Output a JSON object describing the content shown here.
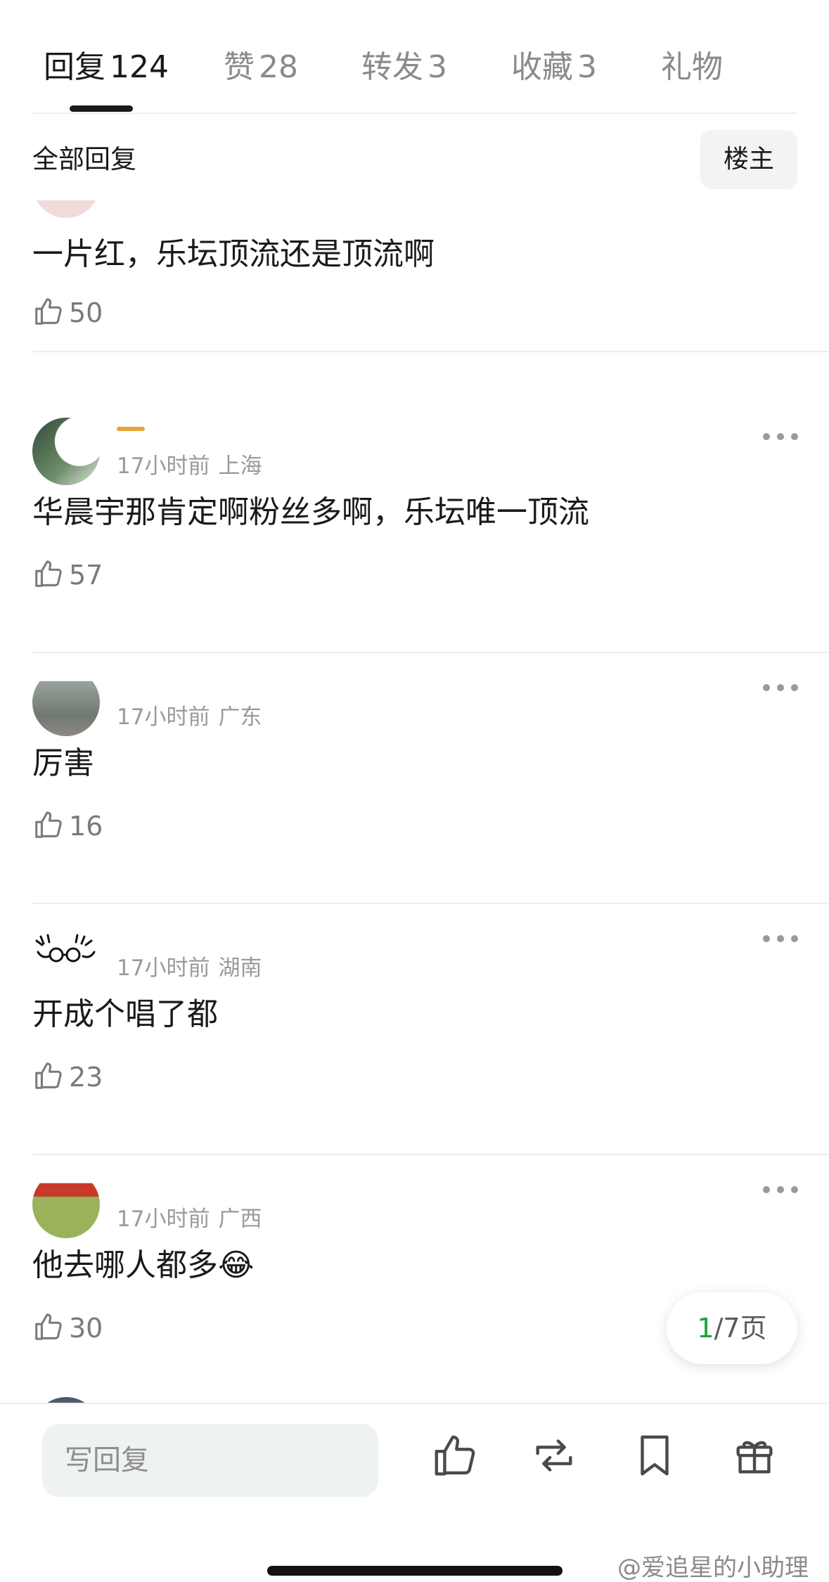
{
  "tabs": [
    {
      "label": "回复",
      "count": "124"
    },
    {
      "label": "赞",
      "count": "28"
    },
    {
      "label": "转发",
      "count": "3"
    },
    {
      "label": "收藏",
      "count": "3"
    },
    {
      "label": "礼物",
      "count": ""
    }
  ],
  "filter": {
    "label": "全部回复",
    "louzhu": "楼主"
  },
  "comments": [
    {
      "time": "",
      "location": "",
      "text": "一片红，乐坛顶流还是顶流啊",
      "likes": "50"
    },
    {
      "time": "17小时前",
      "location": "上海",
      "text": "华晨宇那肯定啊粉丝多啊，乐坛唯一顶流",
      "likes": "57"
    },
    {
      "time": "17小时前",
      "location": "广东",
      "text": "厉害",
      "likes": "16"
    },
    {
      "time": "17小时前",
      "location": "湖南",
      "text": "开成个唱了都",
      "likes": "23"
    },
    {
      "time": "17小时前",
      "location": "广西",
      "text": "他去哪人都多😂",
      "likes": "30"
    }
  ],
  "pagination": {
    "current": "1",
    "total": "/7",
    "unit": "页"
  },
  "bottom": {
    "reply_placeholder": "写回复"
  },
  "watermark": "@爱追星的小助理",
  "colors": {
    "accent_green": "#1f9e3c",
    "text_primary": "#1a1a1a",
    "text_secondary": "#9a9a9a"
  }
}
